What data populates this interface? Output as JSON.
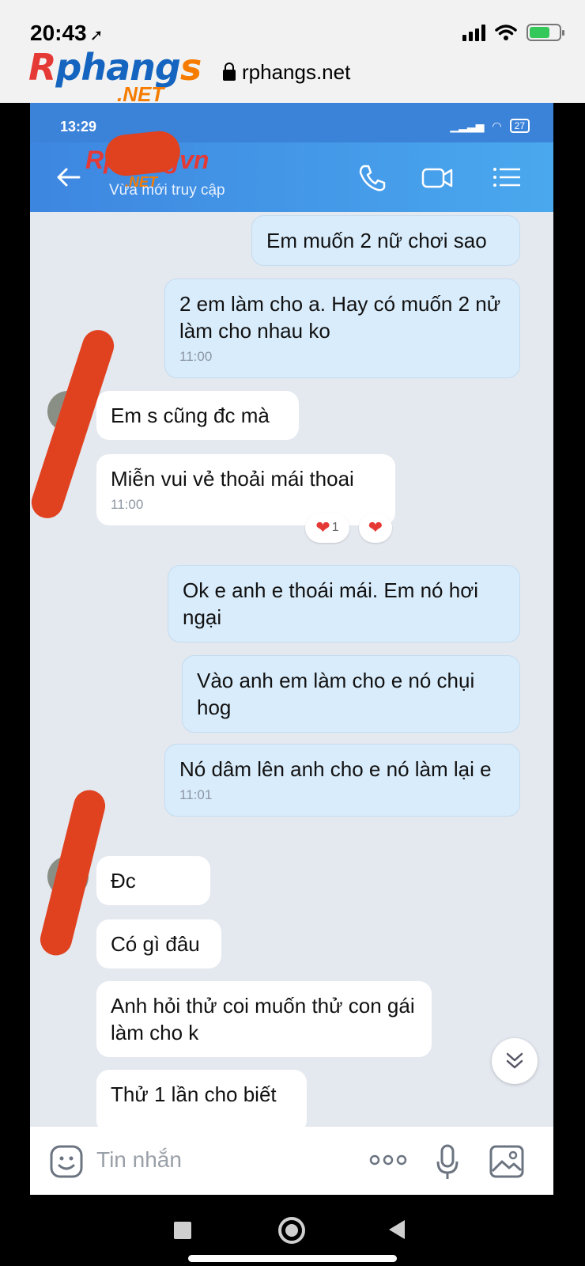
{
  "ios_status": {
    "time": "20:43"
  },
  "watermark": {
    "logo": "Rphangs",
    "net": ".NET",
    "url": "rphangs.net"
  },
  "android_status": {
    "time": "13:29",
    "battery": "27"
  },
  "chat_header": {
    "contact_name": "Rphangvn",
    "contact_sub": ".NET",
    "status": "Vừa mới truy cập"
  },
  "messages": [
    {
      "dir": "out",
      "text": "Em muốn 2 nữ chơi sao",
      "time": ""
    },
    {
      "dir": "out",
      "text": "2 em làm cho a. Hay  có muốn 2 nử làm cho nhau ko",
      "time": "11:00"
    },
    {
      "dir": "in",
      "text": "Em s cũng đc mà",
      "time": ""
    },
    {
      "dir": "in",
      "text": "Miễn vui vẻ thoải mái thoai",
      "time": "11:00"
    },
    {
      "dir": "out",
      "text": "Ok e anh e thoái mái. Em nó hơi ngại",
      "time": ""
    },
    {
      "dir": "out",
      "text": "Vào anh em làm cho e nó chụi hog",
      "time": ""
    },
    {
      "dir": "out",
      "text": "Nó dâm lên anh cho e nó làm lại e",
      "time": "11:01"
    },
    {
      "dir": "in",
      "text": "Đc",
      "time": ""
    },
    {
      "dir": "in",
      "text": "Có gì đâu",
      "time": ""
    },
    {
      "dir": "in",
      "text": "Anh hỏi thử coi muốn thử con gái làm cho k",
      "time": ""
    },
    {
      "dir": "in",
      "text": "Thử 1 lần cho biết",
      "time": ""
    }
  ],
  "reaction": {
    "count": "1"
  },
  "composer": {
    "placeholder": "Tin nhắn"
  },
  "colors": {
    "header": "#3d86e0",
    "outgoing": "#d9ecfb",
    "incoming": "#ffffff",
    "heart": "#e53935"
  },
  "icons": [
    "location-arrow-icon",
    "signal-icon",
    "wifi-icon",
    "battery-icon",
    "lock-icon",
    "back-arrow-icon",
    "phone-icon",
    "video-icon",
    "menu-list-icon",
    "heart-icon",
    "chevron-double-down-icon",
    "sticker-icon",
    "more-icon",
    "microphone-icon",
    "image-icon"
  ]
}
